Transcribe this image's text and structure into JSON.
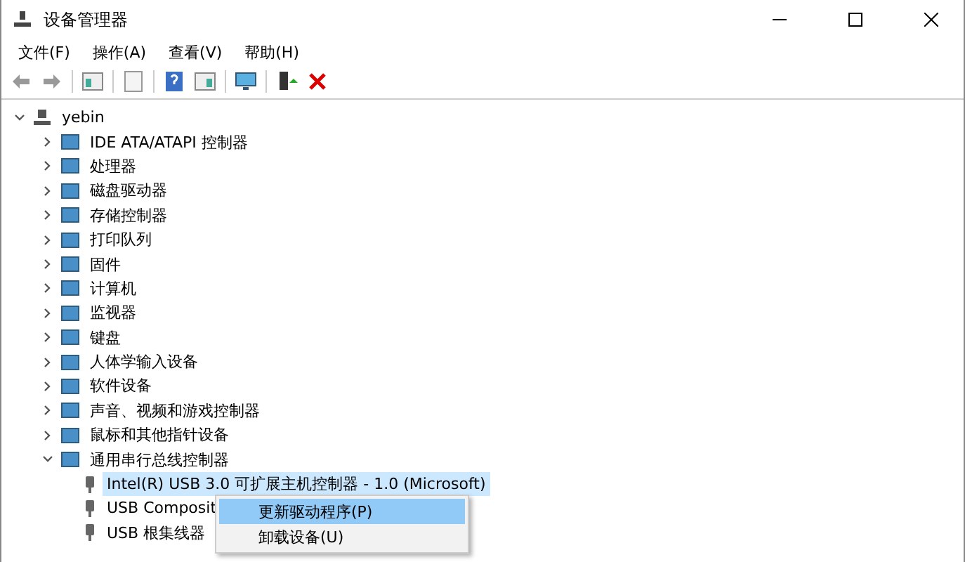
{
  "window": {
    "title": "设备管理器"
  },
  "menu_bar": [
    "文件(F)",
    "操作(A)",
    "查看(V)",
    "帮助(H)"
  ],
  "tree": {
    "label": "yebin",
    "expanded": true,
    "children": [
      {
        "label": "IDE ATA/ATAPI 控制器",
        "expanded": false
      },
      {
        "label": "处理器",
        "expanded": false
      },
      {
        "label": "磁盘驱动器",
        "expanded": false
      },
      {
        "label": "存储控制器",
        "expanded": false
      },
      {
        "label": "打印队列",
        "expanded": false
      },
      {
        "label": "固件",
        "expanded": false
      },
      {
        "label": "计算机",
        "expanded": false
      },
      {
        "label": "监视器",
        "expanded": false
      },
      {
        "label": "键盘",
        "expanded": false
      },
      {
        "label": "人体学输入设备",
        "expanded": false
      },
      {
        "label": "软件设备",
        "expanded": false
      },
      {
        "label": "声音、视频和游戏控制器",
        "expanded": false
      },
      {
        "label": "鼠标和其他指针设备",
        "expanded": false
      },
      {
        "label": "通用串行总线控制器",
        "expanded": true,
        "children": [
          {
            "label": "Intel(R) USB 3.0 可扩展主机控制器 - 1.0 (Microsoft)",
            "selected": true
          },
          {
            "label": "USB Composit",
            "selected": false
          },
          {
            "label": "USB 根集线器",
            "selected": false
          }
        ]
      }
    ]
  },
  "context_menu": [
    {
      "label": "更新驱动程序(P)",
      "selected": true
    },
    {
      "label": "卸载设备(U)",
      "selected": false
    }
  ]
}
